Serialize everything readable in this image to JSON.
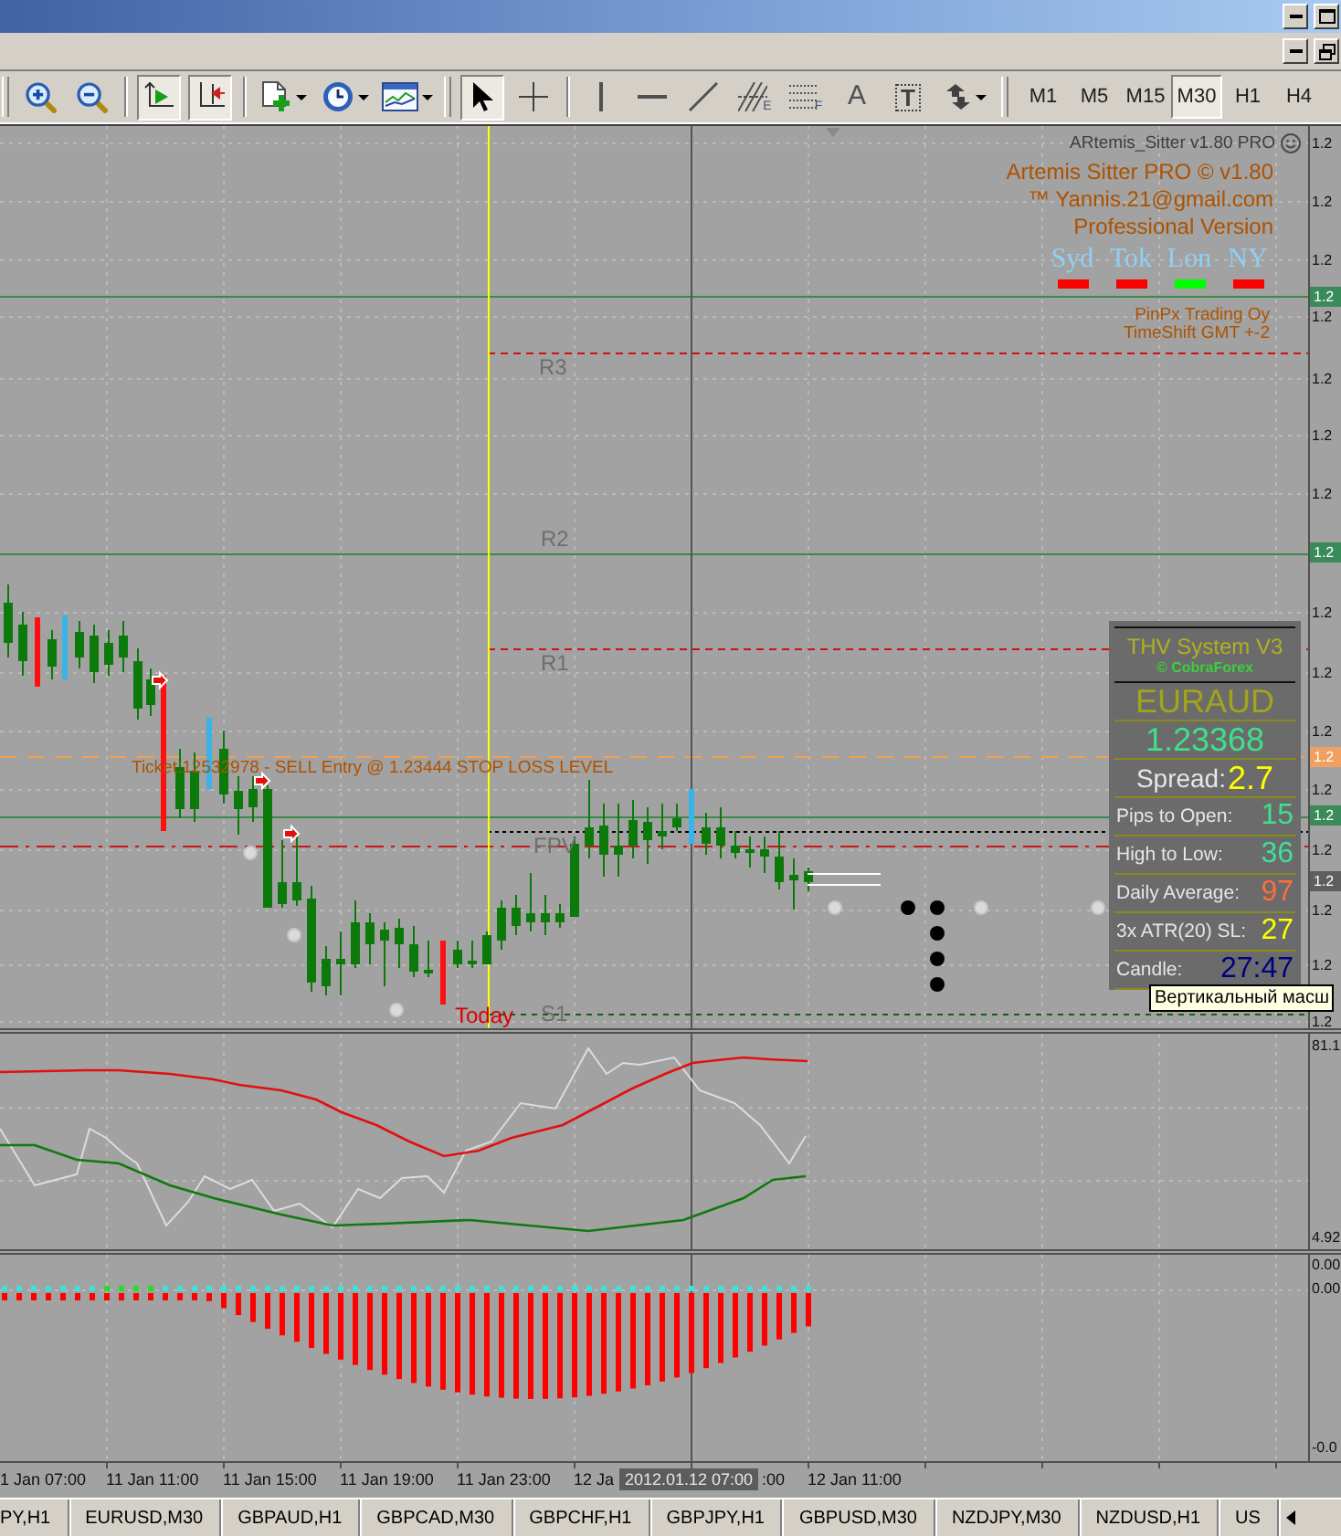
{
  "toolbar": {
    "view_toggles": [
      {
        "kind": "chart_shift",
        "on": true
      },
      {
        "kind": "auto_scroll",
        "on": true
      }
    ],
    "drawing_tools": [
      {
        "kind": "cursor",
        "selected": true
      },
      {
        "kind": "crosshair",
        "selected": false
      },
      {
        "kind": "vertical_line",
        "selected": false
      },
      {
        "kind": "horizontal_line",
        "selected": false
      },
      {
        "kind": "trendline",
        "selected": false
      },
      {
        "kind": "fibo_channel",
        "letter": "E",
        "selected": false
      },
      {
        "kind": "fibo_levels",
        "letter": "F",
        "selected": false
      },
      {
        "kind": "text",
        "letter": "A",
        "selected": false
      },
      {
        "kind": "label",
        "letter": "T",
        "selected": false
      },
      {
        "kind": "arrows",
        "selected": false
      }
    ],
    "timeframes": [
      {
        "label": "M1",
        "selected": false
      },
      {
        "label": "M5",
        "selected": false
      },
      {
        "label": "M15",
        "selected": false
      },
      {
        "label": "M30",
        "selected": true
      },
      {
        "label": "H1",
        "selected": false
      },
      {
        "label": "H4",
        "selected": false
      }
    ]
  },
  "chart": {
    "indicator_name": "ARtemis_Sitter v1.80 PRO",
    "header_lines": [
      "Artemis Sitter PRO © v1.80",
      "™ Yannis.21@gmail.com",
      "Professional Version"
    ],
    "sessions": [
      {
        "label": "Syd",
        "color": "#ff0000"
      },
      {
        "label": "Tok",
        "color": "#ff0000"
      },
      {
        "label": "Lon",
        "color": "#00ff00"
      },
      {
        "label": "NY",
        "color": "#ff0000"
      }
    ],
    "footer_lines": [
      "PinPx Trading Oy",
      "TimeShift GMT +-2"
    ],
    "level_labels": [
      "R3",
      "R2",
      "R1",
      "FPV",
      "S1"
    ],
    "order_label": "Ticket:12532978 - SELL Entry @ 1.23444  STOP LOSS LEVEL",
    "day_label": "Today",
    "price_axis": [
      "1.2",
      "1.2",
      "1.2",
      "1.2",
      "1.2",
      "1.2",
      "1.2",
      "1.2",
      "1.2",
      "1.2",
      "1.2",
      "1.2",
      "1.2",
      "1.2",
      "1.2"
    ],
    "price_tags": [
      {
        "text": "1.2",
        "color": "#3a8a5a"
      },
      {
        "text": "1.2",
        "color": "#3a8a5a"
      },
      {
        "text": "1.2",
        "color": "#f0a060"
      },
      {
        "text": "1.2",
        "color": "#3a8a5a"
      },
      {
        "text": "1.2",
        "color": "#5e5e5e"
      }
    ]
  },
  "thv_panel": {
    "title": "THV System V3",
    "credit": "© CobraForex",
    "symbol": "EURAUD",
    "price": "1.23368",
    "spread": {
      "label": "Spread:",
      "value": "2.7"
    },
    "rows": [
      {
        "label": "Pips to Open:",
        "value": "15"
      },
      {
        "label": "High to Low:",
        "value": "36"
      },
      {
        "label": "Daily Average:",
        "value": "97"
      },
      {
        "label": "3x ATR(20) SL:",
        "value": "27"
      },
      {
        "label": "Candle:",
        "value": "27:47"
      }
    ]
  },
  "tooltip": "Вертикальный масш",
  "oscillator": {
    "axis": [
      "81.1",
      "4.92"
    ]
  },
  "histogram": {
    "axis": [
      "0.00",
      "0.00",
      "-0.0"
    ]
  },
  "time_axis": {
    "labels": [
      "1 Jan 07:00",
      "11 Jan 11:00",
      "11 Jan 15:00",
      "11 Jan 19:00",
      "11 Jan 23:00",
      "12 Ja",
      ":00",
      "12 Jan 11:00"
    ],
    "cursor_label": "2012.01.12 07:00"
  },
  "symbol_tabs": [
    {
      "label": "PY,H1",
      "selected": false
    },
    {
      "label": "EURUSD,M30",
      "selected": false
    },
    {
      "label": "GBPAUD,H1",
      "selected": false
    },
    {
      "label": "GBPCAD,M30",
      "selected": false
    },
    {
      "label": "GBPCHF,H1",
      "selected": false
    },
    {
      "label": "GBPJPY,H1",
      "selected": false
    },
    {
      "label": "GBPUSD,M30",
      "selected": false
    },
    {
      "label": "NZDJPY,M30",
      "selected": false
    },
    {
      "label": "NZDUSD,H1",
      "selected": false
    },
    {
      "label": "US",
      "selected": false
    }
  ]
}
